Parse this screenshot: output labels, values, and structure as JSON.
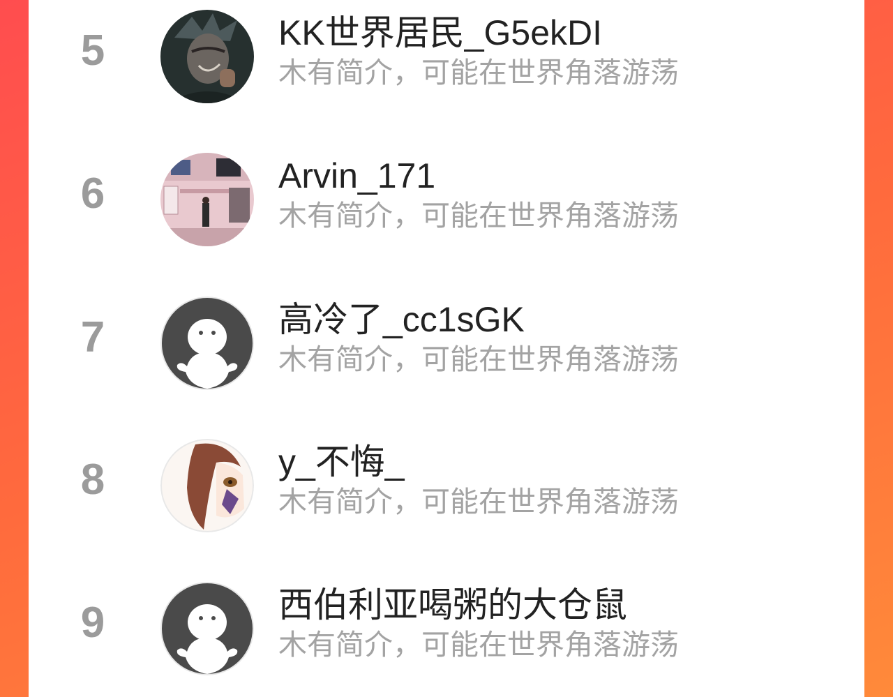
{
  "ranking": {
    "items": [
      {
        "rank": "5",
        "username": "KK世界居民_G5ekDI",
        "bio": "木有简介，可能在世界角落游荡",
        "avatar_icon": "user-photo-dark-character"
      },
      {
        "rank": "6",
        "username": "Arvin_171",
        "bio": "木有简介，可能在世界角落游荡",
        "avatar_icon": "user-photo-street-scene"
      },
      {
        "rank": "7",
        "username": "高冷了_cc1sGK",
        "bio": "木有简介，可能在世界角落游荡",
        "avatar_icon": "default-avatar-icon"
      },
      {
        "rank": "8",
        "username": "y_不悔_",
        "bio": "木有简介，可能在世界角落游荡",
        "avatar_icon": "user-photo-anime-girl"
      },
      {
        "rank": "9",
        "username": "西伯利亚喝粥的大仓鼠",
        "bio": "木有简介，可能在世界角落游荡",
        "avatar_icon": "default-avatar-icon"
      }
    ]
  },
  "colors": {
    "background_gradient_start": "#ff4d4f",
    "background_gradient_end": "#ff8a3a",
    "rank_number": "#9b9b9b",
    "username_text": "#222222",
    "bio_text": "#a3a3a3",
    "default_avatar_bg": "#4a4a4a"
  }
}
